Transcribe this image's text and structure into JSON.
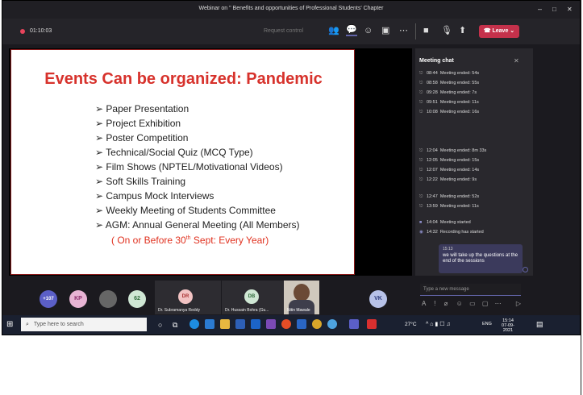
{
  "window": {
    "title": "Webinar on \" Benefits and opportunities of Professional Students' Chapter"
  },
  "toolbar": {
    "timer": "01:10:03",
    "request_control": "Request control",
    "leave_label": "Leave"
  },
  "slide": {
    "title": "Events Can be organized: Pandemic",
    "bullets": [
      "Paper Presentation",
      "Project Exhibition",
      "Poster Competition",
      "Technical/Social Quiz (MCQ Type)",
      "Film Shows (NPTEL/Motivational Videos)",
      "Soft Skills Training",
      "Campus Mock Interviews",
      "Weekly Meeting of Students Committee",
      "AGM: Annual General Meeting (All Members)"
    ],
    "footer_pre": "( On or Before 30",
    "footer_sup": "th",
    "footer_post": " Sept: Every Year)",
    "presenter": "NitinMawale"
  },
  "chat": {
    "title": "Meeting chat",
    "items_a": [
      {
        "time": "08:44",
        "text": "Meeting ended: 54s"
      },
      {
        "time": "08:58",
        "text": "Meeting ended: 55s"
      },
      {
        "time": "09:28",
        "text": "Meeting ended: 7s"
      },
      {
        "time": "09:51",
        "text": "Meeting ended: 11s"
      },
      {
        "time": "10:08",
        "text": "Meeting ended: 16s"
      }
    ],
    "items_b": [
      {
        "time": "12:04",
        "text": "Meeting ended: 8m 33s"
      },
      {
        "time": "12:05",
        "text": "Meeting ended: 15s"
      },
      {
        "time": "12:07",
        "text": "Meeting ended: 14s"
      },
      {
        "time": "12:22",
        "text": "Meeting ended: 9s"
      }
    ],
    "items_c": [
      {
        "time": "12:47",
        "text": "Meeting ended: 52s"
      },
      {
        "time": "13:59",
        "text": "Meeting ended: 11s"
      }
    ],
    "items_d": [
      {
        "time": "14:04",
        "text": "Meeting started"
      },
      {
        "time": "14:32",
        "text": "Recording has started"
      }
    ],
    "message": {
      "time": "15:13",
      "text": "we will take up the questions at the end of the sessions"
    },
    "placeholder": "Type a new message"
  },
  "participants": {
    "overflow": "+107",
    "kp": "KP",
    "n62": "62",
    "dr_initials": "DR",
    "dr_name": "Dr. Subramanya Reddy",
    "db_initials": "DB",
    "db_name": "Dr. Hussain Bohra (Gu...",
    "nitin_name": "Nitin Mawale",
    "vk": "VK"
  },
  "taskbar": {
    "search_placeholder": "Type here to search",
    "temp": "27°C",
    "lang": "ENG",
    "time": "15:14",
    "date": "07-09-2021"
  },
  "colors": {
    "accent": "#6264a7",
    "leave": "#c4314b",
    "slide_title": "#d7322c"
  }
}
